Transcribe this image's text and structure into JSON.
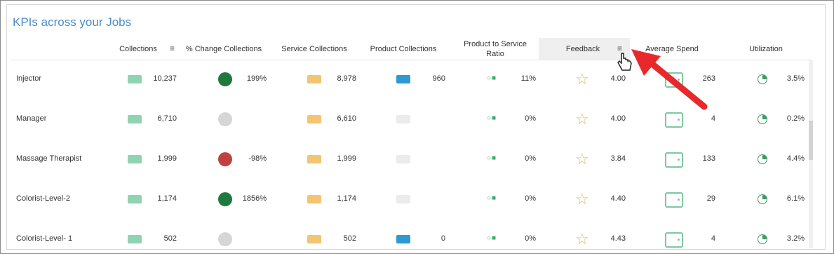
{
  "title": "KPIs across your Jobs",
  "headers": [
    "Collections",
    "% Change Collections",
    "Service Collections",
    "Product Collections",
    "Product to Service Ratio",
    "Feedback",
    "Average Spend",
    "Utilization"
  ],
  "rows": [
    {
      "job": "Injector",
      "collections": "10,237",
      "pct_change": "199%",
      "change_status": "up",
      "service": "8,978",
      "product": "960",
      "ratio": "11%",
      "feedback": "4.00",
      "avg_spend": "263",
      "utilization": "3.5%"
    },
    {
      "job": "Manager",
      "collections": "6,710",
      "pct_change": "",
      "change_status": "neutral",
      "service": "6,610",
      "product": "",
      "ratio": "0%",
      "feedback": "4.00",
      "avg_spend": "4",
      "utilization": "0.2%"
    },
    {
      "job": "Massage Therapist",
      "collections": "1,999",
      "pct_change": "-98%",
      "change_status": "down",
      "service": "1,999",
      "product": "",
      "ratio": "0%",
      "feedback": "3.84",
      "avg_spend": "133",
      "utilization": "4.4%"
    },
    {
      "job": "Colorist-Level-2",
      "collections": "1,174",
      "pct_change": "1856%",
      "change_status": "up",
      "service": "1,174",
      "product": "",
      "ratio": "0%",
      "feedback": "4.40",
      "avg_spend": "29",
      "utilization": "6.1%"
    },
    {
      "job": "Colorist-Level- 1",
      "collections": "502",
      "pct_change": "",
      "change_status": "neutral",
      "service": "502",
      "product": "0",
      "ratio": "0%",
      "feedback": "4.43",
      "avg_spend": "4",
      "utilization": "3.2%"
    }
  ],
  "colors": {
    "up": "#1e7a3c",
    "down": "#c0413d",
    "neutral": "#d6d6d6",
    "accent": "#4a8cc4",
    "arrow": "#e8282b"
  },
  "icons": {
    "collections": "money-icon",
    "service": "money-icon",
    "product": "money-icon",
    "ratio": "ratio-icon",
    "feedback": "star-icon",
    "avg_spend": "wallet-icon",
    "utilization": "pie-icon",
    "sort": "sort-icon",
    "cursor": "hand-cursor-icon"
  }
}
